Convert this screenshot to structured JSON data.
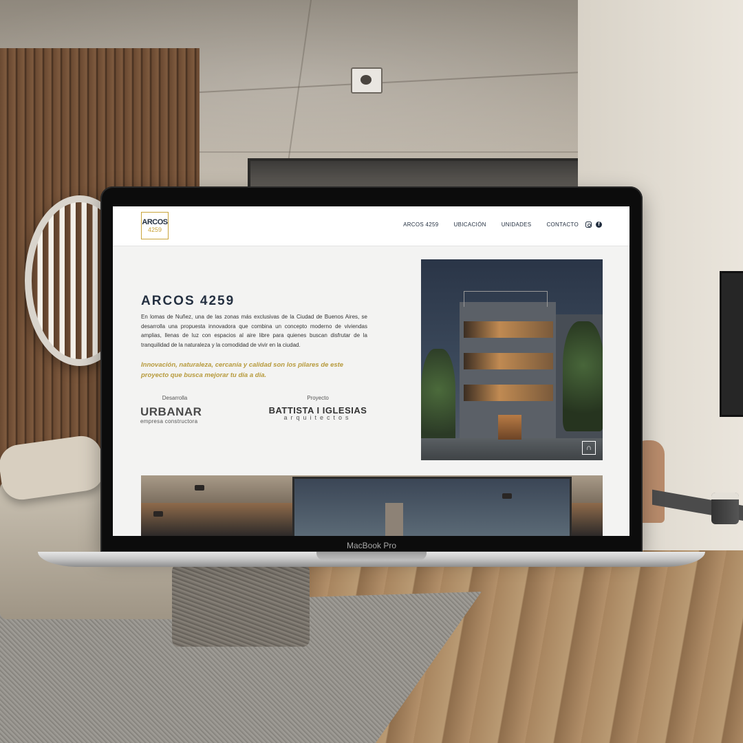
{
  "device": {
    "label": "MacBook Pro"
  },
  "site": {
    "logo": {
      "line1": "ARCOS",
      "line2": "4259"
    },
    "nav": [
      {
        "label": "ARCOS 4259"
      },
      {
        "label": "UBICACIÓN"
      },
      {
        "label": "UNIDADES"
      },
      {
        "label": "CONTACTO"
      }
    ],
    "social": {
      "instagram": "instagram-icon",
      "facebook": "facebook-icon",
      "facebook_glyph": "f"
    },
    "hero": {
      "title": "ARCOS 4259",
      "description": "En lomas de Nuñez, una de las zonas más exclusivas de la Ciudad de Buenos Aires, se desarrolla una propuesta innovadora que combina un concepto moderno de viviendas amplias, llenas de luz con espacios al aire libre para quienes buscan disfrutar de la tranquilidad de la naturaleza y la comodidad de vivir en la ciudad.",
      "quote": "Innovación, naturaleza, cercanía y calidad son los pilares de este proyecto que busca mejorar tu día a día."
    },
    "credits": {
      "developer": {
        "caption": "Desarrolla",
        "brand": "URBANAR",
        "sub": "empresa constructora"
      },
      "project": {
        "caption": "Proyecto",
        "brand": "BATTISTA I IGLESIAS",
        "sub": "arquitectos"
      }
    },
    "render_badge": "∩"
  }
}
